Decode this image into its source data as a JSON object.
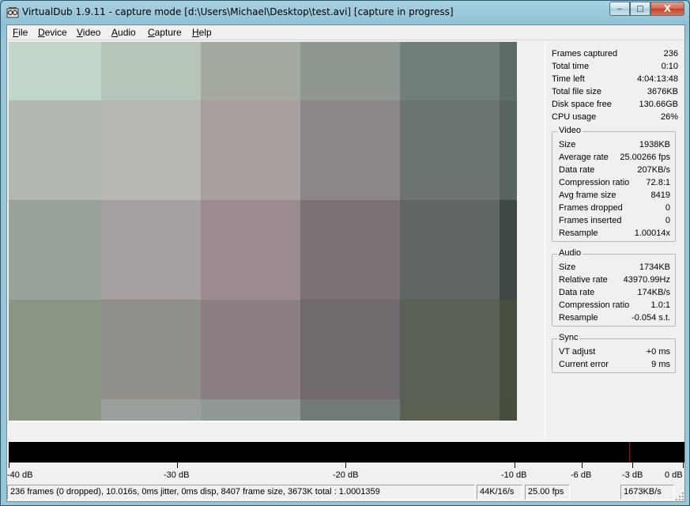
{
  "window": {
    "title": "VirtualDub 1.9.11 - capture mode [d:\\Users\\Michael\\Desktop\\test.avi] [capture in progress]",
    "buttons": {
      "minimize": "‒",
      "maximize": "□",
      "close": "X"
    }
  },
  "menu": [
    "File",
    "Device",
    "Video",
    "Audio",
    "Capture",
    "Help"
  ],
  "stats": {
    "general": [
      {
        "label": "Frames captured",
        "value": "236"
      },
      {
        "label": "Total time",
        "value": "0:10"
      },
      {
        "label": "Time left",
        "value": "4:04:13:48"
      },
      {
        "label": "Total file size",
        "value": "3676KB"
      },
      {
        "label": "Disk space free",
        "value": "130.66GB"
      },
      {
        "label": "CPU usage",
        "value": "26%"
      }
    ],
    "video": {
      "title": "Video",
      "rows": [
        {
          "label": "Size",
          "value": "1938KB"
        },
        {
          "label": "Average rate",
          "value": "25.00266 fps"
        },
        {
          "label": "Data rate",
          "value": "207KB/s"
        },
        {
          "label": "Compression ratio",
          "value": "72.8:1"
        },
        {
          "label": "Avg frame size",
          "value": "8419"
        },
        {
          "label": "Frames dropped",
          "value": "0"
        },
        {
          "label": "Frames inserted",
          "value": "0"
        },
        {
          "label": "Resample",
          "value": "1.00014x"
        }
      ]
    },
    "audio": {
      "title": "Audio",
      "rows": [
        {
          "label": "Size",
          "value": "1734KB"
        },
        {
          "label": "Relative rate",
          "value": "43970.99Hz"
        },
        {
          "label": "Data rate",
          "value": "174KB/s"
        },
        {
          "label": "Compression ratio",
          "value": "1.0:1"
        },
        {
          "label": "Resample",
          "value": "-0.054 s.t."
        }
      ]
    },
    "sync": {
      "title": "Sync",
      "rows": [
        {
          "label": "VT adjust",
          "value": "+0 ms"
        },
        {
          "label": "Current error",
          "value": "9 ms"
        }
      ]
    }
  },
  "meter": {
    "scale": [
      "-40 dB",
      "-30 dB",
      "-20 dB",
      "-10 dB",
      "-6 dB",
      "-3 dB",
      "0 dB"
    ],
    "level_db": -3
  },
  "statusbar": {
    "main": "236 frames (0 dropped), 10.016s, 0ms jitter, 0ms disp, 8407 frame size, 3673K total : 1.0001359",
    "audio_format": "44K/16/s",
    "fps": "25.00 fps",
    "rate": "1673KB/s"
  },
  "colors": {
    "preview_tiles": [
      [
        "#c0d6c8",
        "#b7c4b8",
        "#a4aa9e",
        "#8e9890",
        "#6f7e77",
        "#5f6c66"
      ],
      [
        "#b1b8b1",
        "#b7b7b4",
        "#a7a09e",
        "#8a8689",
        "#6b7473",
        "#586563"
      ],
      [
        "#98a29b",
        "#a7a0a0",
        "#9b8a91",
        "#7d7178",
        "#5f6663",
        "#3d4844"
      ],
      [
        "#8a9585",
        "#908f8a",
        "#8b7f84",
        "#706a6c",
        "#5a6258",
        "#47503f"
      ],
      [
        "#8a9683",
        "#99a09e",
        "#909a95",
        "#727b78",
        "#5a6152",
        "#454d3d"
      ]
    ]
  }
}
